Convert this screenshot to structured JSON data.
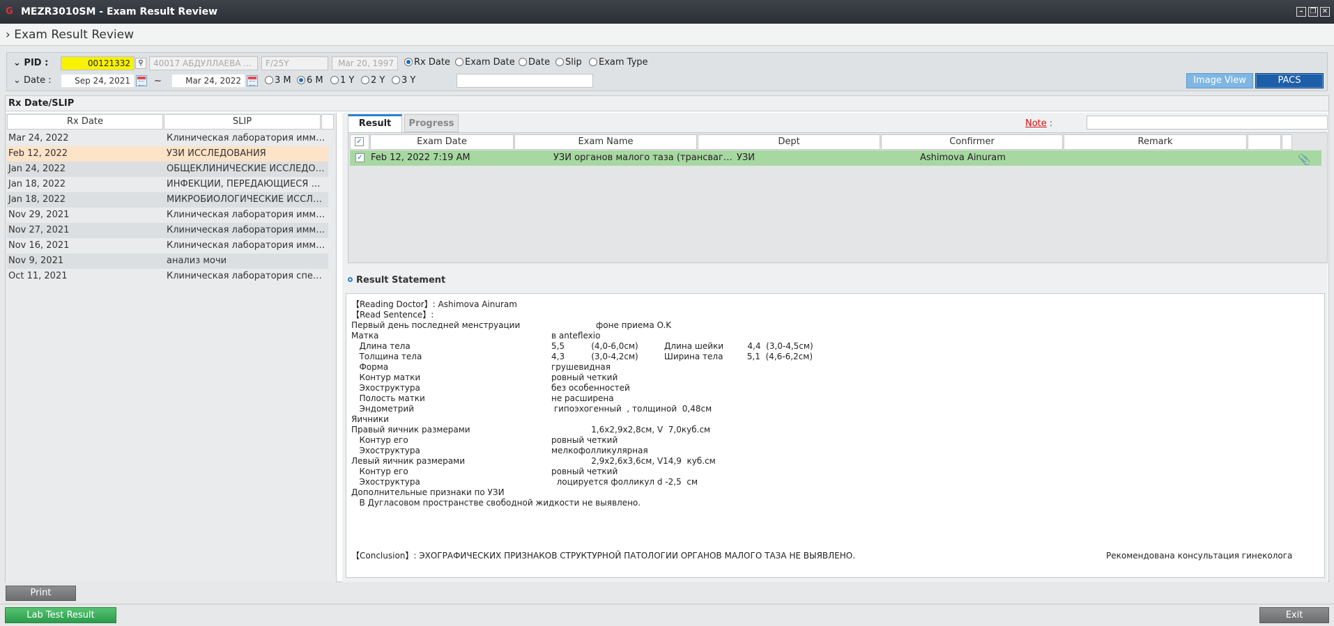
{
  "window": {
    "logo": "G",
    "title": "MEZR3010SM - Exam Result Review",
    "minimize": "–",
    "maximize": "❐",
    "close": "✕"
  },
  "screen_title": "Exam Result Review",
  "filter": {
    "pid_label": "PID :",
    "pid_value": "00121332",
    "pid_search_icon": "search-icon",
    "patient_id_name": "40017  АБДУЛЛАЕВА ...",
    "sex_age": "F/25Y",
    "birth_date": "Mar 20, 1997",
    "date_label": "Date :",
    "date_from": "Sep 24, 2021",
    "date_sep": "~",
    "date_to": "Mar 24, 2022",
    "sort_options": [
      "Rx Date",
      "Exam Date",
      "Date",
      "Slip",
      "Exam Type"
    ],
    "sort_selected": "Rx Date",
    "period_options": [
      "3 M",
      "6 M",
      "1 Y",
      "2 Y",
      "3 Y"
    ],
    "period_selected": "6 M",
    "extra_field": ""
  },
  "buttons": {
    "image_view": "Image View",
    "pacs": "PACS",
    "print": "Print",
    "lab_test_result": "Lab Test Result",
    "exit": "Exit"
  },
  "left_panel": {
    "title": "Rx Date/SLIP",
    "columns": [
      "Rx Date",
      "SLIP"
    ],
    "rows": [
      {
        "date": "Mar 24, 2022",
        "slip": "Клиническая лаборатория иммунологии"
      },
      {
        "date": "Feb 12, 2022",
        "slip": "УЗИ ИССЛЕДОВАНИЯ"
      },
      {
        "date": "Jan 24, 2022",
        "slip": "ОБЩЕКЛИНИЧЕСКИЕ ИССЛЕДОВАНИЯ"
      },
      {
        "date": "Jan 18, 2022",
        "slip": "ИНФЕКЦИИ, ПЕРЕДАЮЩИЕСЯ ПОЛОВЫМ ПУТЕМ"
      },
      {
        "date": "Jan 18, 2022",
        "slip": "МИКРОБИОЛОГИЧЕСКИЕ ИССЛЕДОВАНИЯ"
      },
      {
        "date": "Nov 29, 2021",
        "slip": "Клиническая лаборатория иммунологии"
      },
      {
        "date": "Nov 27, 2021",
        "slip": "Клиническая лаборатория иммунологии"
      },
      {
        "date": "Nov 16, 2021",
        "slip": "Клиническая лаборатория иммунологии"
      },
      {
        "date": "Nov 9, 2021",
        "slip": "анализ мочи"
      },
      {
        "date": "Oct 11, 2021",
        "slip": "Клиническая лаборатория специальных исследований"
      }
    ]
  },
  "tabs": {
    "result": "Result",
    "progress": "Progress"
  },
  "note": {
    "label": "Note",
    "colon": ":",
    "value": ""
  },
  "result_grid": {
    "columns": [
      "Exam Date",
      "Exam Name",
      "Dept",
      "Confirmer",
      "Remark"
    ],
    "rows": [
      {
        "exam_date": "Feb 12, 2022 7:19 AM",
        "exam_name": "УЗИ органов малого таза (трансвагинальное)",
        "dept": "УЗИ",
        "confirmer": "Ashimova Ainuram",
        "remark": "",
        "attachment_icon": "paperclip-icon"
      }
    ]
  },
  "statement": {
    "title": "Result Statement",
    "reading_doctor": "【Reading Doctor】: Ashimova Ainuram",
    "read_sentence": "【Read Sentence】:",
    "lines": [
      {
        "label": "Первый день последней менструации",
        "value": "фоне приема O.K",
        "extra": ""
      },
      {
        "label": "Матка",
        "value": "в anteflexio",
        "extra": ""
      },
      {
        "label": "   Длина тела",
        "value": "5,5          (4,0-6,0см)",
        "extra": "Длина шейки         4,4  (3,0-4,5см)"
      },
      {
        "label": "   Толщина тела",
        "value": "4,3          (3,0-4,2см)",
        "extra": "Ширина тела         5,1  (4,6-6,2см)"
      },
      {
        "label": "   Форма",
        "value": "грушевидная",
        "extra": ""
      },
      {
        "label": "   Контур матки",
        "value": "ровный четкий",
        "extra": ""
      },
      {
        "label": "   Эхоструктура",
        "value": "без особенностей",
        "extra": ""
      },
      {
        "label": "   Полость матки",
        "value": "не расширена",
        "extra": ""
      },
      {
        "label": "   Эндометрий",
        "value": " гипоэхогенный  , толщиной  0,48см",
        "extra": ""
      },
      {
        "label": "Яичники",
        "value": "",
        "extra": ""
      },
      {
        "label": "Правый яичник размерами",
        "value": "               1,6х2,9х2,8см, V  7,0куб.см",
        "extra": ""
      },
      {
        "label": "   Контур его",
        "value": "ровный четкий",
        "extra": ""
      },
      {
        "label": "   Эхоструктура",
        "value": "мелкофолликулярная",
        "extra": ""
      },
      {
        "label": "Левый яичник размерами",
        "value": "               2,9х2,6х3,6см, V14,9  куб.см",
        "extra": ""
      },
      {
        "label": "   Контур его",
        "value": "ровный четкий",
        "extra": ""
      },
      {
        "label": "   Эхоструктура",
        "value": "  лоцируется фолликул d -2,5  см",
        "extra": ""
      },
      {
        "label": "Дополнительные признаки по УЗИ",
        "value": "",
        "extra": ""
      },
      {
        "label": "   В Дугласовом пространстве свободной жидкости не выявлено.",
        "value": "",
        "extra": ""
      }
    ],
    "conclusion": "【Conclusion】: ЭХОГРАФИЧЕСКИХ ПРИЗНАКОВ СТРУКТУРНОЙ ПАТОЛОГИИ ОРГАНОВ МАЛОГО ТАЗА НЕ ВЫЯВЛЕНО.",
    "recommendation": "Рекомендована консультация гинеколога"
  },
  "colors": {
    "titlebar": "#2f3338",
    "pid_highlight": "#f8f200",
    "selected_row": "#fde3c7",
    "result_row": "#a7d8a1",
    "tab_accent": "#2b7fd0",
    "lab_button": "#3aa857",
    "pacs_button": "#1c5ea8",
    "note_label": "#d11111"
  }
}
